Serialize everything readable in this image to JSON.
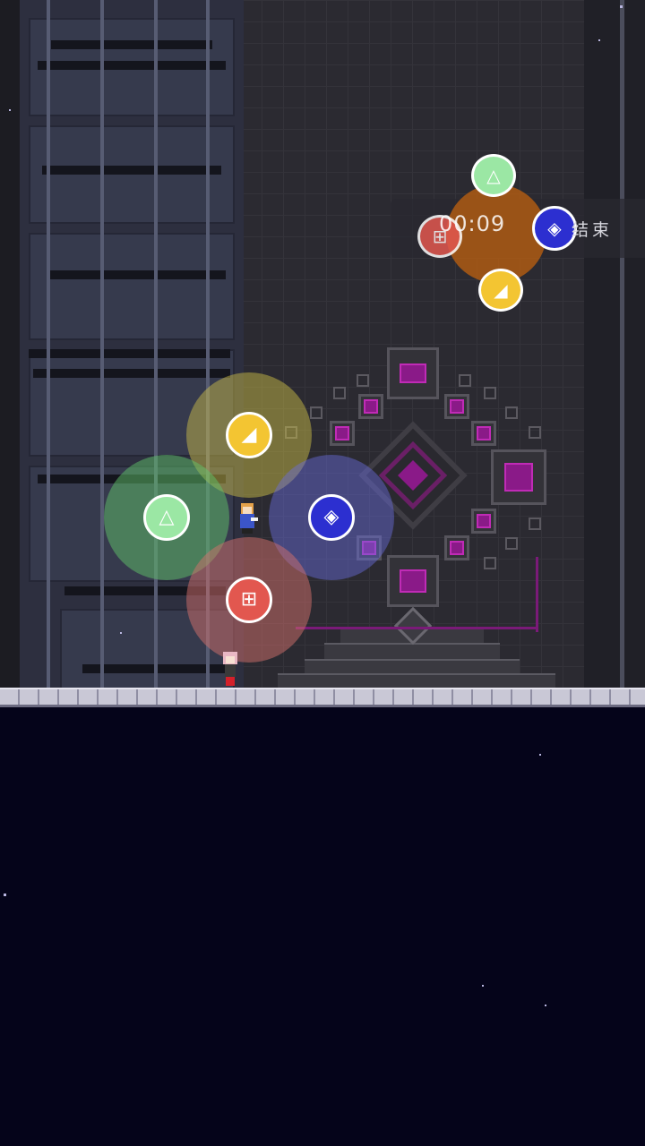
{
  "hud": {
    "timer": "00:09",
    "end_label": "结束"
  },
  "skill_wheel": {
    "center_character": "fox-girl-icon",
    "buttons": [
      {
        "name": "yellow",
        "symbol": "◢",
        "color": "#f3c532",
        "halo": "#d8c84a"
      },
      {
        "name": "green",
        "symbol": "△",
        "color": "#9be7a4",
        "halo": "#5fc26a"
      },
      {
        "name": "blue",
        "symbol": "◈",
        "color": "#2c2fd0",
        "halo": "#6a6de0"
      },
      {
        "name": "red",
        "symbol": "⊞",
        "color": "#e2574f",
        "halo": "#d4706c"
      }
    ]
  },
  "mini_wheel": {
    "buttons": [
      {
        "name": "green",
        "symbol": "△",
        "color": "#9be7a4"
      },
      {
        "name": "yellow",
        "symbol": "◢",
        "color": "#f3c532"
      },
      {
        "name": "red",
        "symbol": "⊞",
        "color": "#e2574f"
      },
      {
        "name": "blue",
        "symbol": "◈",
        "color": "#2c2fd0"
      }
    ],
    "halo": "#c0620f"
  },
  "colors": {
    "background_void": "#05041a",
    "accent_magenta": "#8a1a88"
  }
}
